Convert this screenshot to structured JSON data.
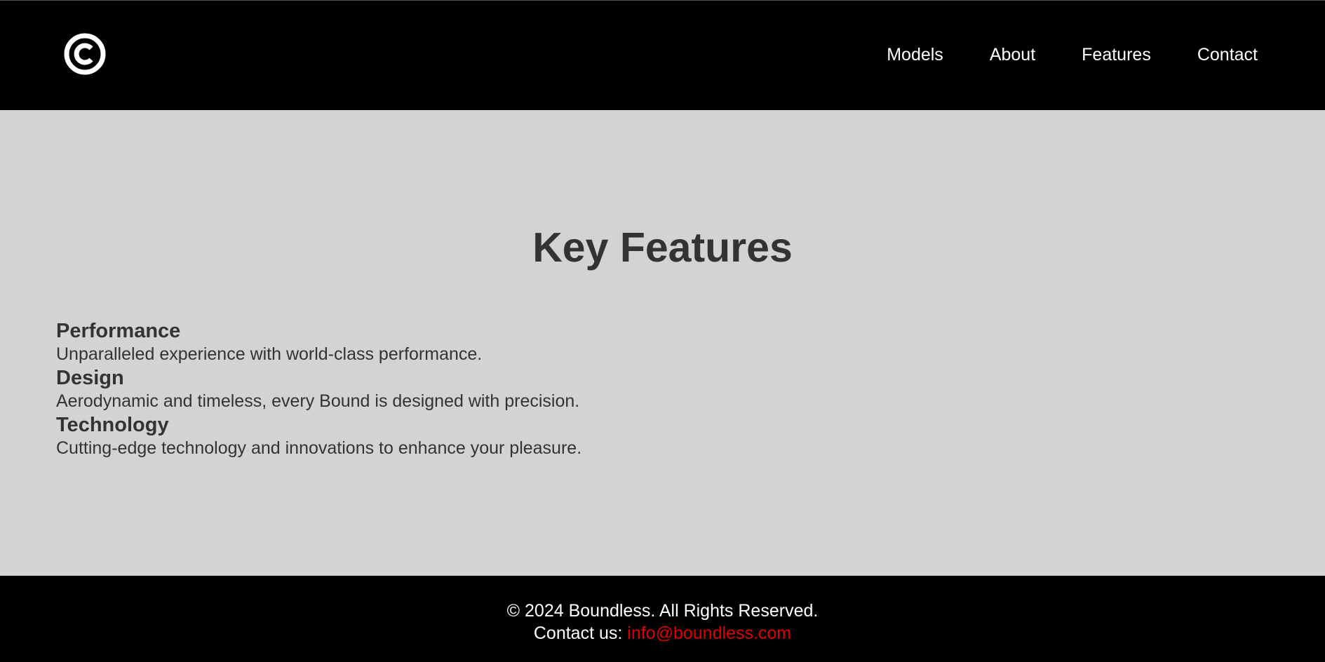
{
  "header": {
    "logo_icon": "copyright-circle-icon",
    "nav": [
      {
        "label": "Models"
      },
      {
        "label": "About"
      },
      {
        "label": "Features"
      },
      {
        "label": "Contact"
      }
    ]
  },
  "main": {
    "title": "Key Features",
    "features": [
      {
        "title": "Performance",
        "description": "Unparalleled experience with world-class performance."
      },
      {
        "title": "Design",
        "description": "Aerodynamic and timeless, every Bound is designed with precision."
      },
      {
        "title": "Technology",
        "description": "Cutting-edge technology and innovations to enhance your pleasure."
      }
    ]
  },
  "footer": {
    "copyright": "© 2024 Boundless. All Rights Reserved.",
    "contact_label": "Contact us:",
    "email": "info@boundless.com"
  },
  "colors": {
    "header_bg": "#000000",
    "main_bg": "#d3d3d3",
    "text": "#333333",
    "link_accent": "#e00000"
  }
}
